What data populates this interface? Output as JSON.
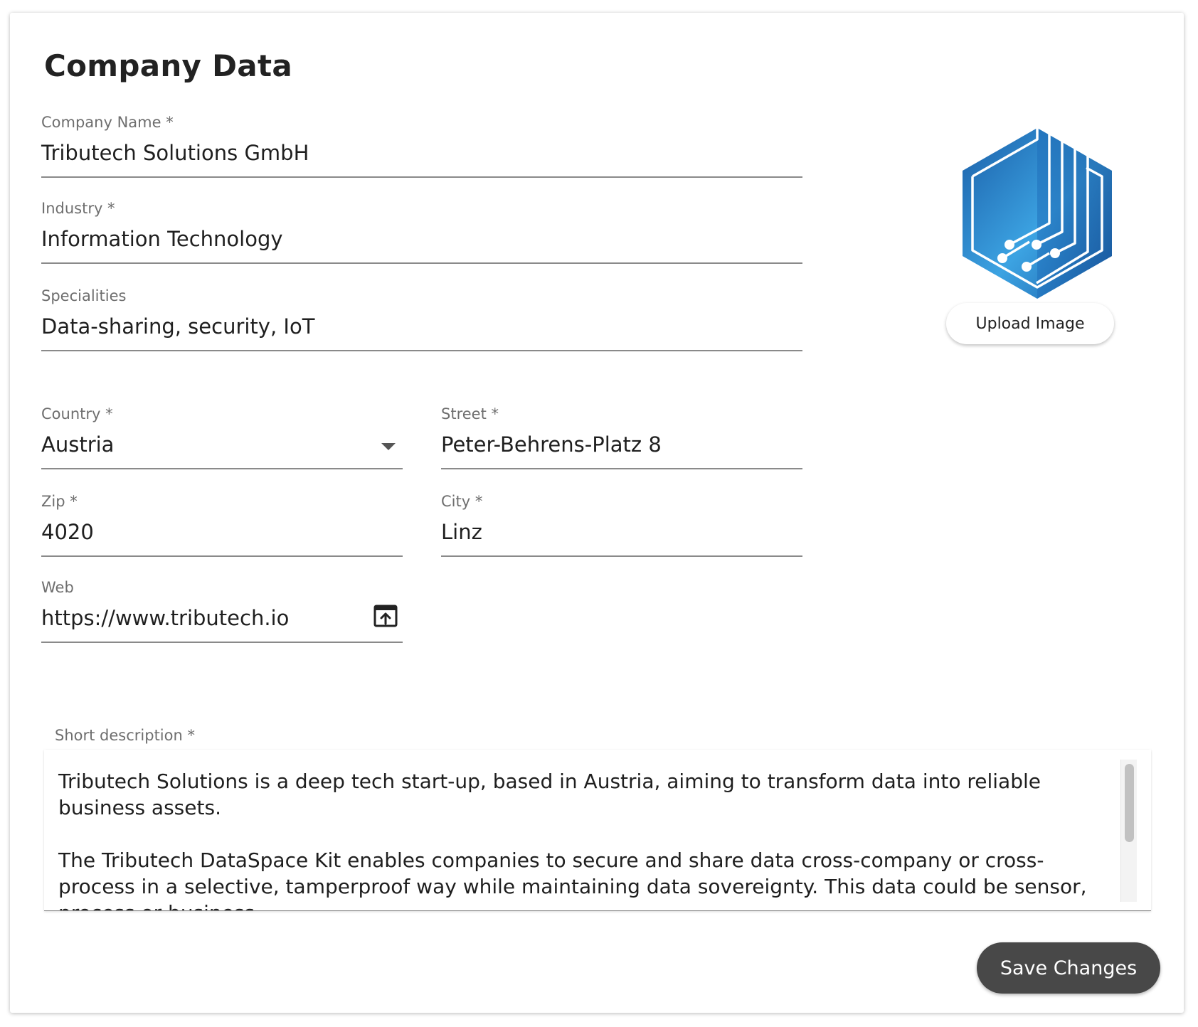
{
  "page": {
    "title": "Company Data"
  },
  "fields": {
    "company_name": {
      "label": "Company Name *",
      "value": "Tributech Solutions GmbH"
    },
    "industry": {
      "label": "Industry *",
      "value": "Information Technology"
    },
    "specialities": {
      "label": "Specialities",
      "value": "Data-sharing, security, IoT"
    },
    "country": {
      "label": "Country *",
      "value": "Austria"
    },
    "street": {
      "label": "Street *",
      "value": "Peter-Behrens-Platz 8"
    },
    "zip": {
      "label": "Zip *",
      "value": "4020"
    },
    "city": {
      "label": "City *",
      "value": "Linz"
    },
    "web": {
      "label": "Web",
      "value": "https://www.tributech.io"
    }
  },
  "description": {
    "label": "Short description *",
    "paragraph_1": "Tributech Solutions is a deep tech start-up, based in Austria, aiming to transform data into reliable business assets.",
    "paragraph_2": "The Tributech DataSpace Kit enables companies to secure and share data cross-company or cross-process in a selective, tamperproof way while maintaining data sovereignty. This data could be sensor, process or business"
  },
  "logo": {
    "icon": "company-logo-hexagon",
    "colors": [
      "#1b5fa8",
      "#3aa0e0",
      "#ffffff"
    ]
  },
  "actions": {
    "upload_label": "Upload Image",
    "save_label": "Save Changes"
  },
  "icons": {
    "country_dropdown": "chevron-down-icon",
    "web_open": "open-in-new-icon"
  },
  "colors": {
    "save_button_bg": "#484848",
    "label_text": "#6e6e6e",
    "underline": "#8a8a8a"
  }
}
